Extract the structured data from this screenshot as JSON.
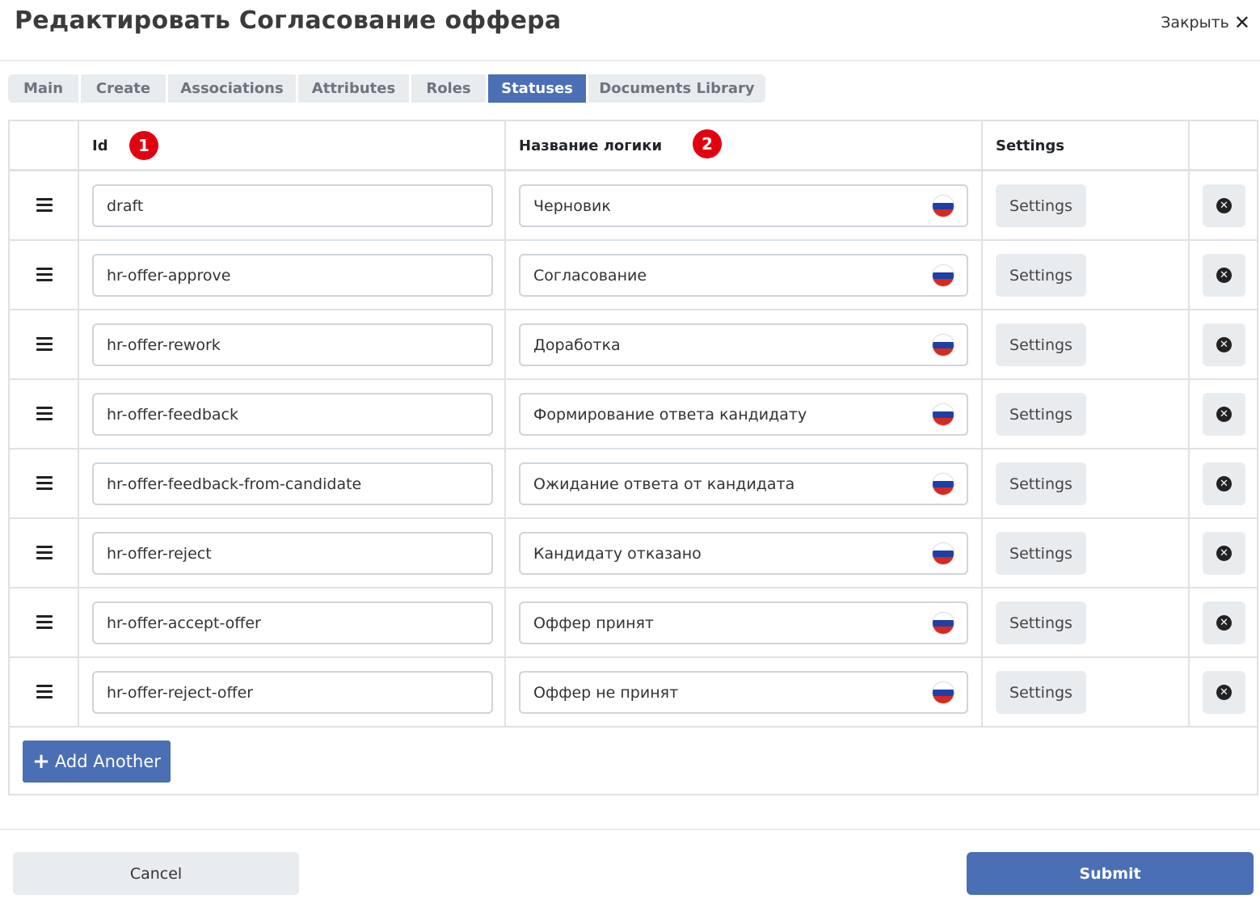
{
  "modal": {
    "title": "Редактировать Согласование оффера",
    "close_label": "Закрыть",
    "close_icon": "close-icon"
  },
  "tabs": [
    {
      "label": "Main",
      "active": false
    },
    {
      "label": "Create",
      "active": false
    },
    {
      "label": "Associations",
      "active": false
    },
    {
      "label": "Attributes",
      "active": false
    },
    {
      "label": "Roles",
      "active": false
    },
    {
      "label": "Statuses",
      "active": true
    },
    {
      "label": "Documents Library",
      "active": false
    }
  ],
  "table": {
    "headers": {
      "id": "Id",
      "name": "Название логики",
      "settings": "Settings"
    },
    "badges": {
      "id": "1",
      "name": "2"
    },
    "rows": [
      {
        "id": "draft",
        "name": "Черновик",
        "settings_label": "Settings"
      },
      {
        "id": "hr-offer-approve",
        "name": "Согласование",
        "settings_label": "Settings"
      },
      {
        "id": "hr-offer-rework",
        "name": "Доработка",
        "settings_label": "Settings"
      },
      {
        "id": "hr-offer-feedback",
        "name": "Формирование ответа кандидату",
        "settings_label": "Settings"
      },
      {
        "id": "hr-offer-feedback-from-candidate",
        "name": "Ожидание ответа от кандидата",
        "settings_label": "Settings"
      },
      {
        "id": "hr-offer-reject",
        "name": "Кандидату отказано",
        "settings_label": "Settings"
      },
      {
        "id": "hr-offer-accept-offer",
        "name": "Оффер принят",
        "settings_label": "Settings"
      },
      {
        "id": "hr-offer-reject-offer",
        "name": "Оффер не принят",
        "settings_label": "Settings"
      }
    ],
    "add_label": "Add Another"
  },
  "footer": {
    "cancel_label": "Cancel",
    "submit_label": "Submit"
  },
  "colors": {
    "accent": "#4a6fb5",
    "badge": "#e3000f",
    "button_gray": "#e9ecef"
  },
  "icons": {
    "drag": "drag-handle-icon",
    "flag": "russian-flag-icon",
    "remove": "remove-circle-icon",
    "add": "plus-icon"
  }
}
